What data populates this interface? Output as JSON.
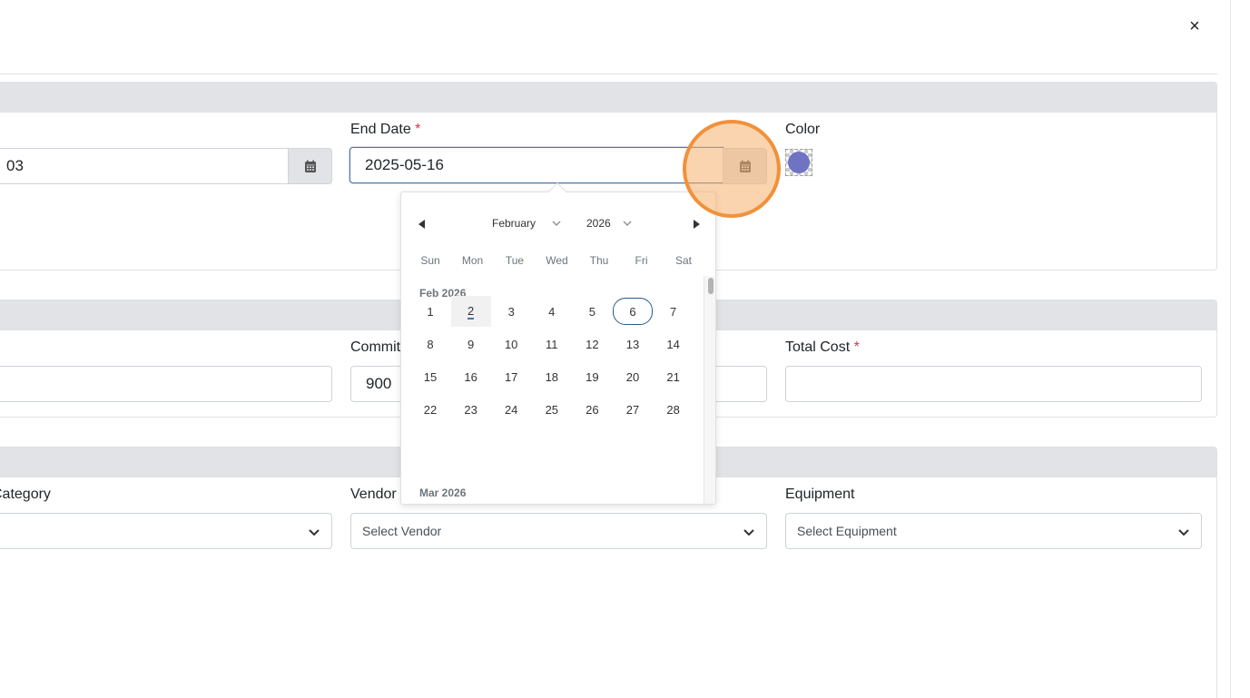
{
  "modal": {
    "close_glyph": "×"
  },
  "schedule": {
    "start_date_value_partial": "03",
    "end_date": {
      "label": "End Date",
      "required_mark": "*",
      "value": "2025-05-16"
    },
    "color": {
      "label": "Color",
      "value": "#6f73c2"
    }
  },
  "costs": {
    "committed_label_partial": "Commit",
    "committed_value": "900",
    "total_cost": {
      "label": "Total Cost",
      "required_mark": "*",
      "value": ""
    }
  },
  "assignment": {
    "category_label_partial": "Category",
    "vendor": {
      "label": "Vendor",
      "placeholder": "Select Vendor"
    },
    "equipment": {
      "label": "Equipment",
      "placeholder": "Select Equipment"
    }
  },
  "datepicker": {
    "month": "February",
    "year": "2026",
    "weekdays": [
      "Sun",
      "Mon",
      "Tue",
      "Wed",
      "Thu",
      "Fri",
      "Sat"
    ],
    "current_month_label": "Feb 2026",
    "next_month_label": "Mar 2026",
    "today": 2,
    "highlighted": 6,
    "weeks": [
      [
        "1",
        "2",
        "3",
        "4",
        "5",
        "6",
        "7"
      ],
      [
        "8",
        "9",
        "10",
        "11",
        "12",
        "13",
        "14"
      ],
      [
        "15",
        "16",
        "17",
        "18",
        "19",
        "20",
        "21"
      ],
      [
        "22",
        "23",
        "24",
        "25",
        "26",
        "27",
        "28"
      ]
    ]
  },
  "icons": {
    "close": "close-icon",
    "calendar": "calendar-icon",
    "chevron": "chevron-down-icon",
    "prev": "triangle-left-icon",
    "next": "triangle-right-icon"
  }
}
